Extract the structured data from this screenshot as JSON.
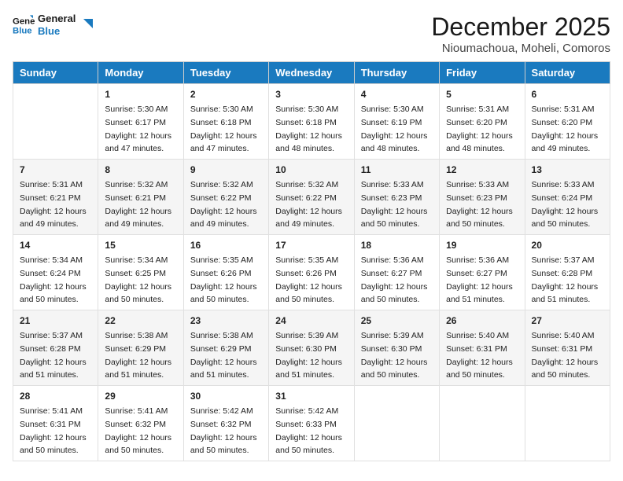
{
  "logo": {
    "line1": "General",
    "line2": "Blue"
  },
  "title": "December 2025",
  "subtitle": "Nioumachoua, Moheli, Comoros",
  "headers": [
    "Sunday",
    "Monday",
    "Tuesday",
    "Wednesday",
    "Thursday",
    "Friday",
    "Saturday"
  ],
  "weeks": [
    [
      {
        "day": "",
        "info": ""
      },
      {
        "day": "1",
        "info": "Sunrise: 5:30 AM\nSunset: 6:17 PM\nDaylight: 12 hours\nand 47 minutes."
      },
      {
        "day": "2",
        "info": "Sunrise: 5:30 AM\nSunset: 6:18 PM\nDaylight: 12 hours\nand 47 minutes."
      },
      {
        "day": "3",
        "info": "Sunrise: 5:30 AM\nSunset: 6:18 PM\nDaylight: 12 hours\nand 48 minutes."
      },
      {
        "day": "4",
        "info": "Sunrise: 5:30 AM\nSunset: 6:19 PM\nDaylight: 12 hours\nand 48 minutes."
      },
      {
        "day": "5",
        "info": "Sunrise: 5:31 AM\nSunset: 6:20 PM\nDaylight: 12 hours\nand 48 minutes."
      },
      {
        "day": "6",
        "info": "Sunrise: 5:31 AM\nSunset: 6:20 PM\nDaylight: 12 hours\nand 49 minutes."
      }
    ],
    [
      {
        "day": "7",
        "info": "Sunrise: 5:31 AM\nSunset: 6:21 PM\nDaylight: 12 hours\nand 49 minutes."
      },
      {
        "day": "8",
        "info": "Sunrise: 5:32 AM\nSunset: 6:21 PM\nDaylight: 12 hours\nand 49 minutes."
      },
      {
        "day": "9",
        "info": "Sunrise: 5:32 AM\nSunset: 6:22 PM\nDaylight: 12 hours\nand 49 minutes."
      },
      {
        "day": "10",
        "info": "Sunrise: 5:32 AM\nSunset: 6:22 PM\nDaylight: 12 hours\nand 49 minutes."
      },
      {
        "day": "11",
        "info": "Sunrise: 5:33 AM\nSunset: 6:23 PM\nDaylight: 12 hours\nand 50 minutes."
      },
      {
        "day": "12",
        "info": "Sunrise: 5:33 AM\nSunset: 6:23 PM\nDaylight: 12 hours\nand 50 minutes."
      },
      {
        "day": "13",
        "info": "Sunrise: 5:33 AM\nSunset: 6:24 PM\nDaylight: 12 hours\nand 50 minutes."
      }
    ],
    [
      {
        "day": "14",
        "info": "Sunrise: 5:34 AM\nSunset: 6:24 PM\nDaylight: 12 hours\nand 50 minutes."
      },
      {
        "day": "15",
        "info": "Sunrise: 5:34 AM\nSunset: 6:25 PM\nDaylight: 12 hours\nand 50 minutes."
      },
      {
        "day": "16",
        "info": "Sunrise: 5:35 AM\nSunset: 6:26 PM\nDaylight: 12 hours\nand 50 minutes."
      },
      {
        "day": "17",
        "info": "Sunrise: 5:35 AM\nSunset: 6:26 PM\nDaylight: 12 hours\nand 50 minutes."
      },
      {
        "day": "18",
        "info": "Sunrise: 5:36 AM\nSunset: 6:27 PM\nDaylight: 12 hours\nand 50 minutes."
      },
      {
        "day": "19",
        "info": "Sunrise: 5:36 AM\nSunset: 6:27 PM\nDaylight: 12 hours\nand 51 minutes."
      },
      {
        "day": "20",
        "info": "Sunrise: 5:37 AM\nSunset: 6:28 PM\nDaylight: 12 hours\nand 51 minutes."
      }
    ],
    [
      {
        "day": "21",
        "info": "Sunrise: 5:37 AM\nSunset: 6:28 PM\nDaylight: 12 hours\nand 51 minutes."
      },
      {
        "day": "22",
        "info": "Sunrise: 5:38 AM\nSunset: 6:29 PM\nDaylight: 12 hours\nand 51 minutes."
      },
      {
        "day": "23",
        "info": "Sunrise: 5:38 AM\nSunset: 6:29 PM\nDaylight: 12 hours\nand 51 minutes."
      },
      {
        "day": "24",
        "info": "Sunrise: 5:39 AM\nSunset: 6:30 PM\nDaylight: 12 hours\nand 51 minutes."
      },
      {
        "day": "25",
        "info": "Sunrise: 5:39 AM\nSunset: 6:30 PM\nDaylight: 12 hours\nand 50 minutes."
      },
      {
        "day": "26",
        "info": "Sunrise: 5:40 AM\nSunset: 6:31 PM\nDaylight: 12 hours\nand 50 minutes."
      },
      {
        "day": "27",
        "info": "Sunrise: 5:40 AM\nSunset: 6:31 PM\nDaylight: 12 hours\nand 50 minutes."
      }
    ],
    [
      {
        "day": "28",
        "info": "Sunrise: 5:41 AM\nSunset: 6:31 PM\nDaylight: 12 hours\nand 50 minutes."
      },
      {
        "day": "29",
        "info": "Sunrise: 5:41 AM\nSunset: 6:32 PM\nDaylight: 12 hours\nand 50 minutes."
      },
      {
        "day": "30",
        "info": "Sunrise: 5:42 AM\nSunset: 6:32 PM\nDaylight: 12 hours\nand 50 minutes."
      },
      {
        "day": "31",
        "info": "Sunrise: 5:42 AM\nSunset: 6:33 PM\nDaylight: 12 hours\nand 50 minutes."
      },
      {
        "day": "",
        "info": ""
      },
      {
        "day": "",
        "info": ""
      },
      {
        "day": "",
        "info": ""
      }
    ]
  ]
}
